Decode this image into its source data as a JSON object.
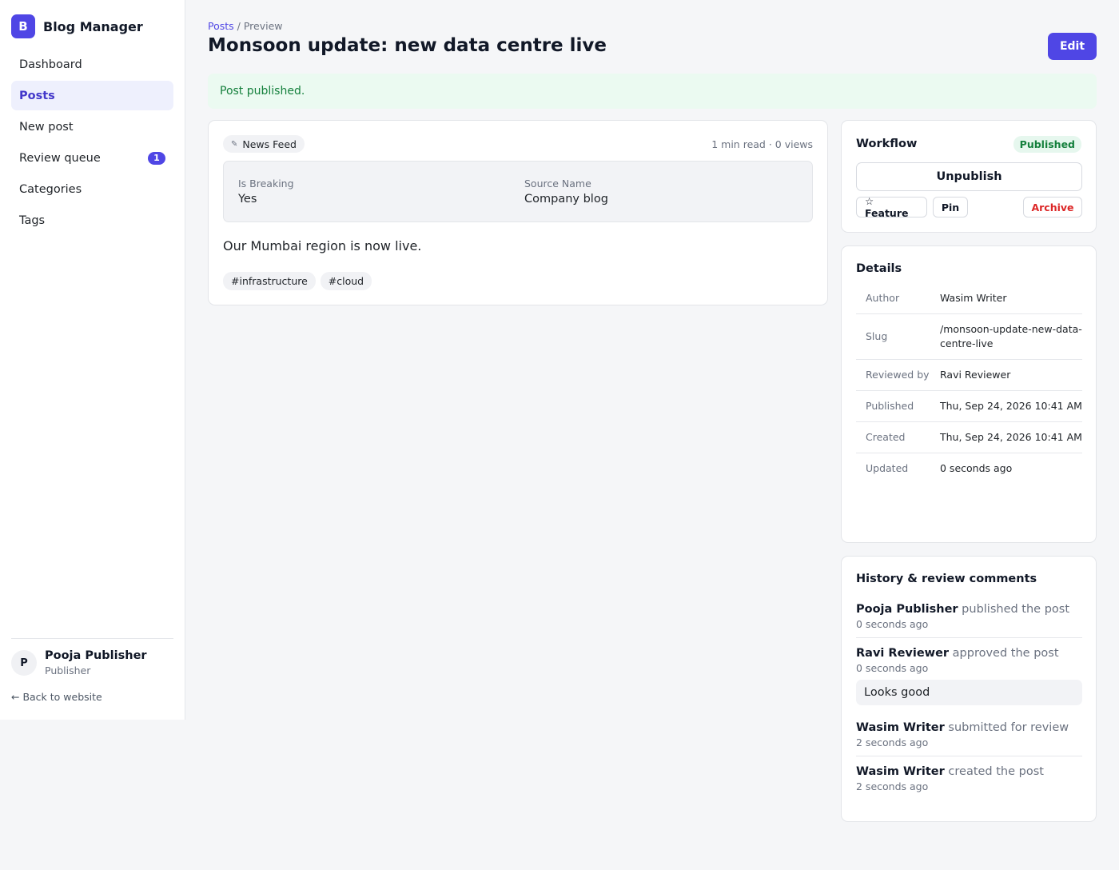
{
  "brand": {
    "logo_letter": "B",
    "name": "Blog Manager"
  },
  "nav": [
    {
      "label": "Dashboard"
    },
    {
      "label": "Posts",
      "active": true
    },
    {
      "label": "New post"
    },
    {
      "label": "Review queue",
      "badge": "1"
    },
    {
      "label": "Categories"
    },
    {
      "label": "Tags"
    }
  ],
  "user": {
    "initial": "P",
    "name": "Pooja Publisher",
    "role": "Publisher"
  },
  "back_link": "← Back to website",
  "breadcrumb": {
    "link": "Posts",
    "separator": " / ",
    "current": "Preview"
  },
  "title": "Monsoon update: new data centre live",
  "edit_label": "Edit",
  "flash": "Post published.",
  "post": {
    "feed_icon": "newspaper-icon",
    "feed": "News Feed",
    "meta": "1 min read · 0 views",
    "fields": [
      {
        "label": "Is Breaking",
        "value": "Yes"
      },
      {
        "label": "Source Name",
        "value": "Company blog"
      }
    ],
    "body": "Our Mumbai region is now live.",
    "tags": [
      "#infrastructure",
      "#cloud"
    ]
  },
  "workflow": {
    "title": "Workflow",
    "status": "Published",
    "unpublish": "Unpublish",
    "feature": "☆ Feature",
    "pin": "Pin",
    "archive": "Archive"
  },
  "details": {
    "title": "Details",
    "rows": [
      {
        "key": "Author",
        "value": "Wasim Writer"
      },
      {
        "key": "Slug",
        "value": "/monsoon-update-new-data-centre-live"
      },
      {
        "key": "Reviewed by",
        "value": "Ravi Reviewer"
      },
      {
        "key": "Published",
        "value": "Thu, Sep 24, 2026 10:41 AM"
      },
      {
        "key": "Created",
        "value": "Thu, Sep 24, 2026 10:41 AM"
      },
      {
        "key": "Updated",
        "value": "0 seconds ago"
      }
    ]
  },
  "history": {
    "title": "History & review comments",
    "items": [
      {
        "actor": "Pooja Publisher",
        "action": "published the post",
        "time": "0 seconds ago"
      },
      {
        "actor": "Ravi Reviewer",
        "action": "approved the post",
        "time": "0 seconds ago",
        "comment": "Looks good"
      },
      {
        "actor": "Wasim Writer",
        "action": "submitted for review",
        "time": "2 seconds ago"
      },
      {
        "actor": "Wasim Writer",
        "action": "created the post",
        "time": "2 seconds ago"
      }
    ]
  },
  "colors": {
    "accent": "#4f46e5",
    "success": "#15803d",
    "danger": "#dc2626"
  }
}
